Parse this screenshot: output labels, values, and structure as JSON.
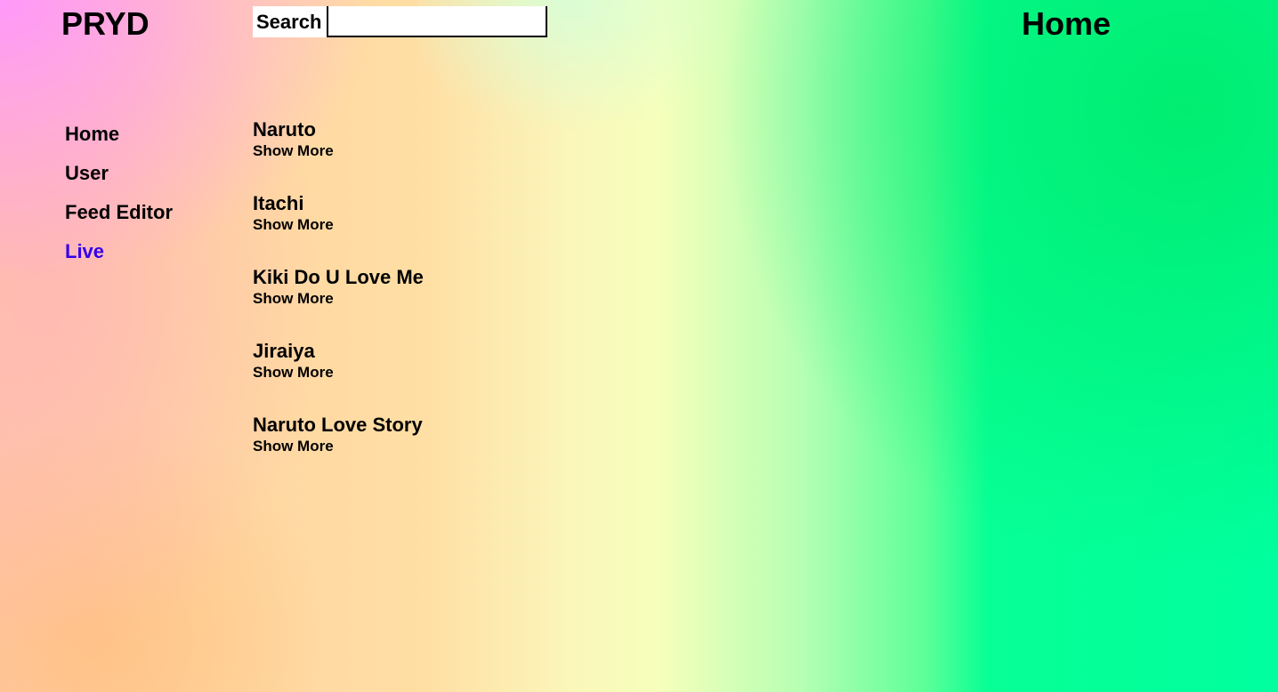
{
  "header": {
    "logo": "PRYD",
    "search": {
      "label": "Search",
      "value": "",
      "placeholder": ""
    },
    "page_title": "Home"
  },
  "sidebar": {
    "items": [
      {
        "label": "Home"
      },
      {
        "label": "User"
      },
      {
        "label": "Feed Editor"
      },
      {
        "label": "Live",
        "active": true
      }
    ]
  },
  "feed": {
    "items": [
      {
        "title": "Naruto",
        "action": "Show More"
      },
      {
        "title": "Itachi",
        "action": "Show More"
      },
      {
        "title": "Kiki Do U Love Me",
        "action": "Show More"
      },
      {
        "title": "Jiraiya",
        "action": "Show More"
      },
      {
        "title": "Naruto Love Story",
        "action": "Show More"
      }
    ]
  },
  "colors": {
    "active_link": "#3300ee",
    "text": "#000000",
    "gradient_pink": "#ff96ff",
    "gradient_peach": "#ffd6a2",
    "gradient_yellow": "#f6ffbb",
    "gradient_green": "#00ff9e"
  }
}
